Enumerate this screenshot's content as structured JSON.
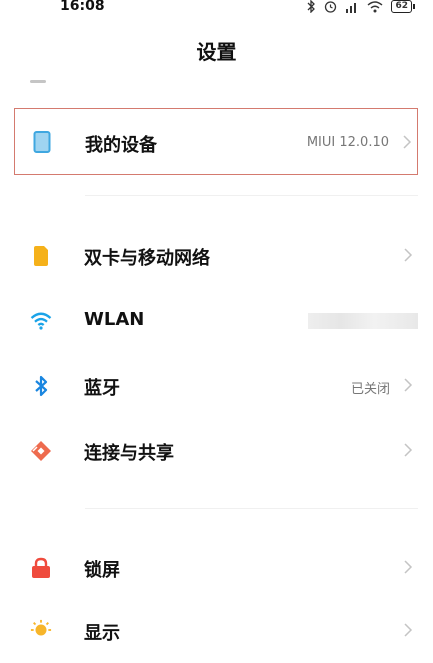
{
  "status_bar": {
    "time": "16:08",
    "battery": "62",
    "icons": [
      "bluetooth-icon",
      "alarm-icon",
      "signal-icon",
      "wifi-icon",
      "battery-icon"
    ]
  },
  "header": {
    "title": "设置"
  },
  "settings": [
    {
      "label": "我的设备",
      "value": "MIUI 12.0.10",
      "icon": "phone-device-icon",
      "color": "#3fa7e0"
    },
    {
      "label": "双卡与移动网络",
      "value": "",
      "icon": "sim-card-icon",
      "color": "#f5b11a"
    },
    {
      "label": "WLAN",
      "value": "",
      "icon": "wifi-icon",
      "color": "#1aa3e8"
    },
    {
      "label": "蓝牙",
      "value": "已关闭",
      "icon": "bluetooth-icon",
      "color": "#1a86e0"
    },
    {
      "label": "连接与共享",
      "value": "",
      "icon": "connection-share-icon",
      "color": "#ee6b4e"
    },
    {
      "label": "锁屏",
      "value": "",
      "icon": "lock-icon",
      "color": "#ef4b3d"
    },
    {
      "label": "显示",
      "value": "",
      "icon": "brightness-icon",
      "color": "#f7b52a"
    }
  ]
}
